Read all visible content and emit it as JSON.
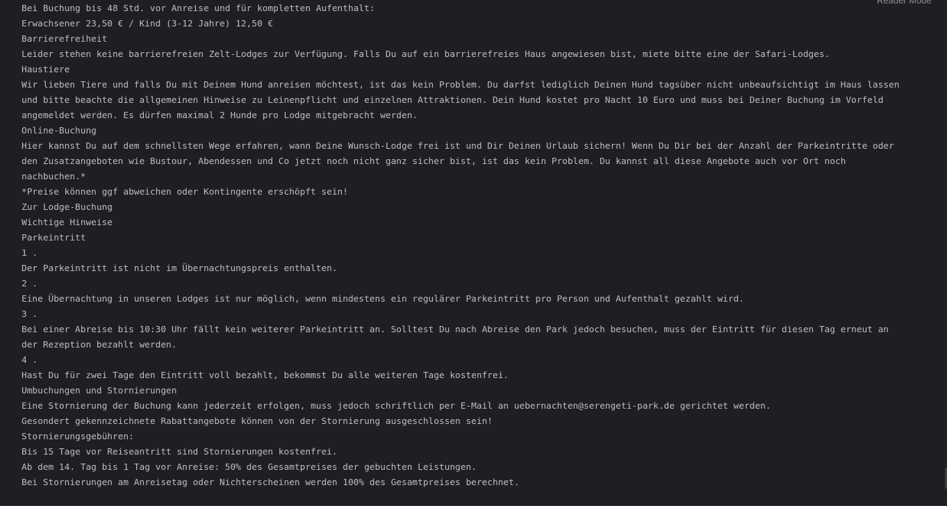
{
  "toolbar": {
    "reader_mode": "Reader Mode"
  },
  "lines": [
    "Bei Buchung bis 48 Std. vor Anreise und für kompletten Aufenthalt:",
    "Erwachsener 23,50 € / Kind (3-12 Jahre) 12,50 €",
    "Barrierefreiheit",
    "Leider stehen keine barrierefreien Zelt-Lodges zur Verfügung. Falls Du auf ein barrierefreies Haus angewiesen bist, miete bitte eine der Safari-Lodges.",
    "Haustiere",
    "Wir lieben Tiere und falls Du mit Deinem Hund anreisen möchtest, ist das kein Problem. Du darfst lediglich Deinen Hund tagsüber nicht unbeaufsichtigt im Haus lassen",
    "  und bitte beachte die allgemeinen Hinweise zu Leinenpflicht und einzelnen Attraktionen. Dein Hund kostet pro Nacht 10 Euro und muss bei Deiner Buchung im Vorfeld",
    " angemeldet werden. Es dürfen maximal 2 Hunde pro Lodge mitgebracht werden.",
    "Online-Buchung",
    "Hier kannst Du auf dem schnellsten Wege erfahren, wann Deine Wunsch-Lodge frei ist und Dir Deinen Urlaub sichern! Wenn Du Dir bei der Anzahl der Parkeintritte oder",
    " den Zusatzangeboten wie Bustour, Abendessen und Co jetzt noch nicht ganz sicher bist, ist das kein Problem. Du kannst all diese Angebote auch vor Ort noch",
    " nachbuchen.*",
    "*Preise können ggf abweichen oder Kontingente erschöpft sein!",
    "Zur Lodge-Buchung",
    "Wichtige Hinweise",
    "Parkeintritt",
    "1 .",
    "Der Parkeintritt ist nicht im Übernachtungspreis enthalten.",
    "2 .",
    "Eine Übernachtung in unseren Lodges ist nur möglich, wenn mindestens ein regulärer Parkeintritt pro Person und Aufenthalt gezahlt wird.",
    "3 .",
    "Bei einer Abreise bis 10:30 Uhr fällt kein weiterer Parkeintritt an. Solltest Du nach Abreise den Park jedoch besuchen, muss der Eintritt für diesen Tag erneut an",
    " der Rezeption bezahlt werden.",
    "4 .",
    "Hast Du für zwei Tage den Eintritt voll bezahlt, bekommst Du alle weiteren Tage kostenfrei.",
    "Umbuchungen und Stornierungen",
    "Eine Stornierung der Buchung kann jederzeit erfolgen, muss jedoch schriftlich per E-Mail an uebernachten@serengeti-park.de gerichtet werden.",
    "Gesondert gekennzeichnete Rabattangebote können von der Stornierung ausgeschlossen sein!",
    "Stornierungsgebühren:",
    "Bis 15 Tage vor Reiseantritt sind Stornierungen kostenfrei.",
    "Ab dem 14. Tag bis 1 Tag vor Anreise: 50% des Gesamtpreises der gebuchten Leistungen.",
    "Bei Stornierungen am Anreisetag oder Nichterscheinen werden 100% des Gesamtpreises berechnet."
  ]
}
